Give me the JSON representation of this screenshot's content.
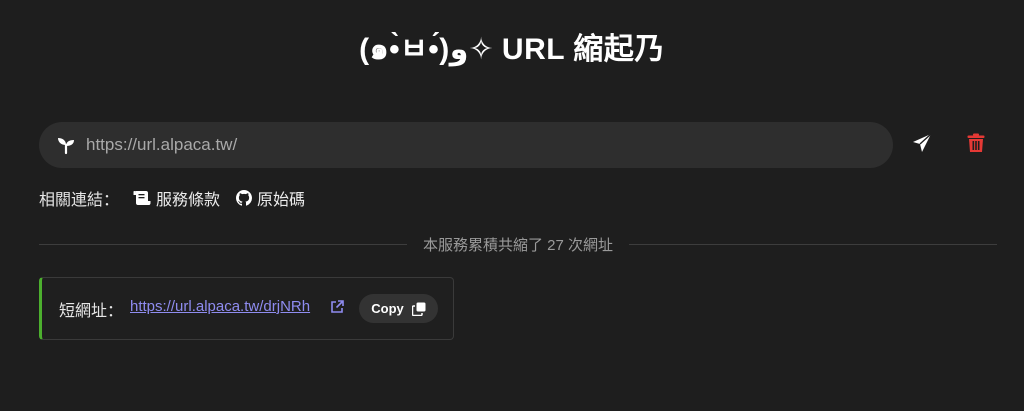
{
  "header": {
    "title": "(๑•̀ㅂ•́)و✧ URL 縮起乃"
  },
  "url_form": {
    "placeholder": "https://url.alpaca.tw/",
    "icon": "sprout-icon",
    "submit_icon": "paper-plane-icon",
    "clear_icon": "trash-icon",
    "clear_color": "#e53935"
  },
  "links": {
    "label": "相關連結：",
    "items": [
      {
        "label": "服務條款",
        "icon": "scroll-icon"
      },
      {
        "label": "原始碼",
        "icon": "github-icon"
      }
    ]
  },
  "stats": {
    "text": "本服務累積共縮了 27 次網址"
  },
  "result": {
    "label": "短網址：",
    "short_url": "https://url.alpaca.tw/drjNRh",
    "external_icon": "external-link-icon",
    "copy_label": "Copy",
    "copy_icon": "copy-icon",
    "accent_color": "#4caf2e",
    "link_color": "#8f8cf0"
  }
}
